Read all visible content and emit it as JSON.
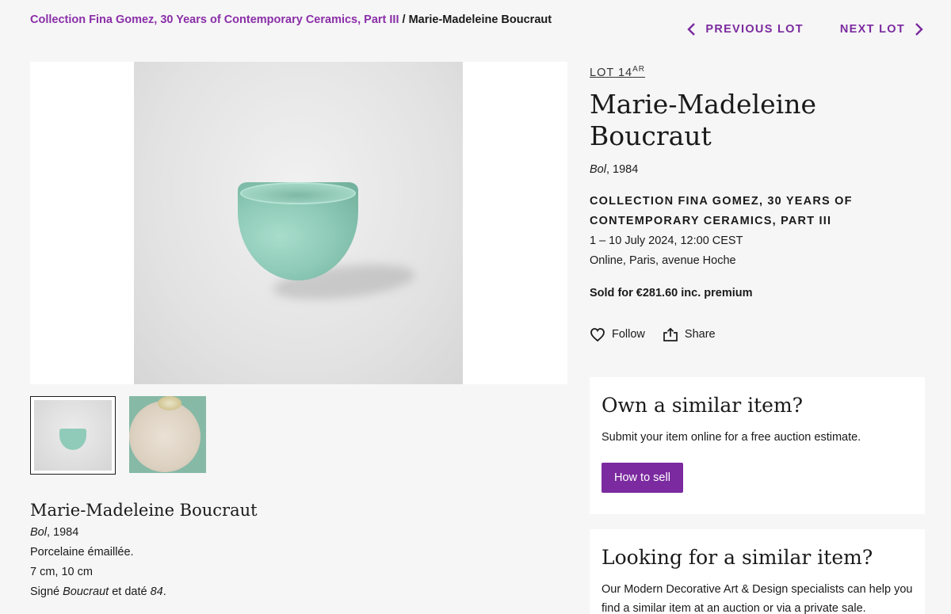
{
  "breadcrumb": {
    "parent": "Collection Fina Gomez, 30 Years of Contemporary Ceramics, Part III",
    "separator": "/",
    "current": "Marie-Madeleine Boucraut"
  },
  "lot_nav": {
    "previous": "PREVIOUS LOT",
    "next": "NEXT LOT"
  },
  "lot": {
    "label": "LOT 14",
    "label_sup": "AR",
    "artist": "Marie-Madeleine Boucraut",
    "title_italic": "Bol",
    "year_suffix": ", 1984"
  },
  "sale": {
    "name_line1": "COLLECTION FINA GOMEZ, 30 YEARS OF",
    "name_line2": "CONTEMPORARY CERAMICS, PART III",
    "dates": "1 – 10 July 2024, 12:00 CEST",
    "location": "Online, Paris, avenue Hoche"
  },
  "sold": "Sold for €281.60 inc. premium",
  "actions": {
    "follow": "Follow",
    "share": "Share"
  },
  "description": {
    "artist": "Marie-Madeleine Boucraut",
    "title_italic": "Bol",
    "year_suffix": ", 1984",
    "material": "Porcelaine émaillée.",
    "dimensions": "7 cm, 10 cm",
    "signed_prefix": "Signé ",
    "signed_italic": "Boucraut",
    "signed_middle": " et daté ",
    "signed_italic2": "84",
    "signed_end": "."
  },
  "card_sell": {
    "title": "Own a similar item?",
    "text": "Submit your item online for a free auction estimate.",
    "button": "How to sell"
  },
  "card_find": {
    "title": "Looking for a similar item?",
    "text": "Our Modern Decorative Art & Design specialists can help you find a similar item at an auction or via a private sale."
  },
  "colors": {
    "accent": "#7b2a9f",
    "background": "#f6f6f6"
  }
}
